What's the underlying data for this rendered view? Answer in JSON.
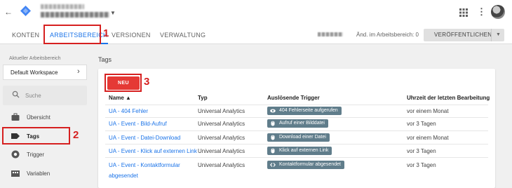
{
  "nav": {
    "tabs": [
      {
        "label": "KONTEN"
      },
      {
        "label": "ARBEITSBEREICH",
        "active": true
      },
      {
        "label": "VERSIONEN"
      },
      {
        "label": "VERWALTUNG"
      }
    ],
    "changes_label": "Änd. im Arbeitsbereich: 0",
    "publish_label": "VERÖFFENTLICHEN"
  },
  "annotations": [
    "1",
    "2",
    "3"
  ],
  "sidebar": {
    "workspace_label": "Aktueller Arbeitsbereich",
    "workspace_name": "Default Workspace",
    "search_placeholder": "Suche",
    "items": [
      {
        "label": "Übersicht",
        "icon": "briefcase-icon"
      },
      {
        "label": "Tags",
        "icon": "tag-icon",
        "active": true
      },
      {
        "label": "Trigger",
        "icon": "trigger-icon"
      },
      {
        "label": "Variablen",
        "icon": "variables-icon"
      }
    ]
  },
  "main": {
    "title": "Tags",
    "new_button": "NEU",
    "columns": {
      "name": "Name ▲",
      "type": "Typ",
      "trigger": "Auslösende Trigger",
      "edited": "Uhrzeit der letzten Bearbeitung"
    },
    "rows": [
      {
        "name": "UA - 404 Fehler",
        "type": "Universal Analytics",
        "trigger": "404 Fehlerseite aufgerufen",
        "trigger_icon": "eye-icon",
        "edited": "vor einem Monat"
      },
      {
        "name": "UA - Event - Bild-Aufruf",
        "type": "Universal Analytics",
        "trigger": "Aufruf einer Bilddatei",
        "trigger_icon": "mouse-icon",
        "edited": "vor 3 Tagen"
      },
      {
        "name": "UA - Event - Datei-Download",
        "type": "Universal Analytics",
        "trigger": "Download einer Datei",
        "trigger_icon": "mouse-icon",
        "edited": "vor einem Monat"
      },
      {
        "name": "UA - Event - Klick auf externen Link",
        "type": "Universal Analytics",
        "trigger": "Klick auf externen Link",
        "trigger_icon": "mouse-icon",
        "edited": "vor 3 Tagen"
      },
      {
        "name": "UA - Event - Kontaktformular",
        "name_line2": "abgesendet",
        "type": "Universal Analytics",
        "trigger": "Kontaktformular abgesendet",
        "trigger_icon": "code-icon",
        "edited": "vor 3 Tagen"
      }
    ]
  },
  "colors": {
    "accent": "#1a73e8",
    "new_button": "#e53935",
    "annotation": "#d62020",
    "chip": "#607d8b"
  }
}
